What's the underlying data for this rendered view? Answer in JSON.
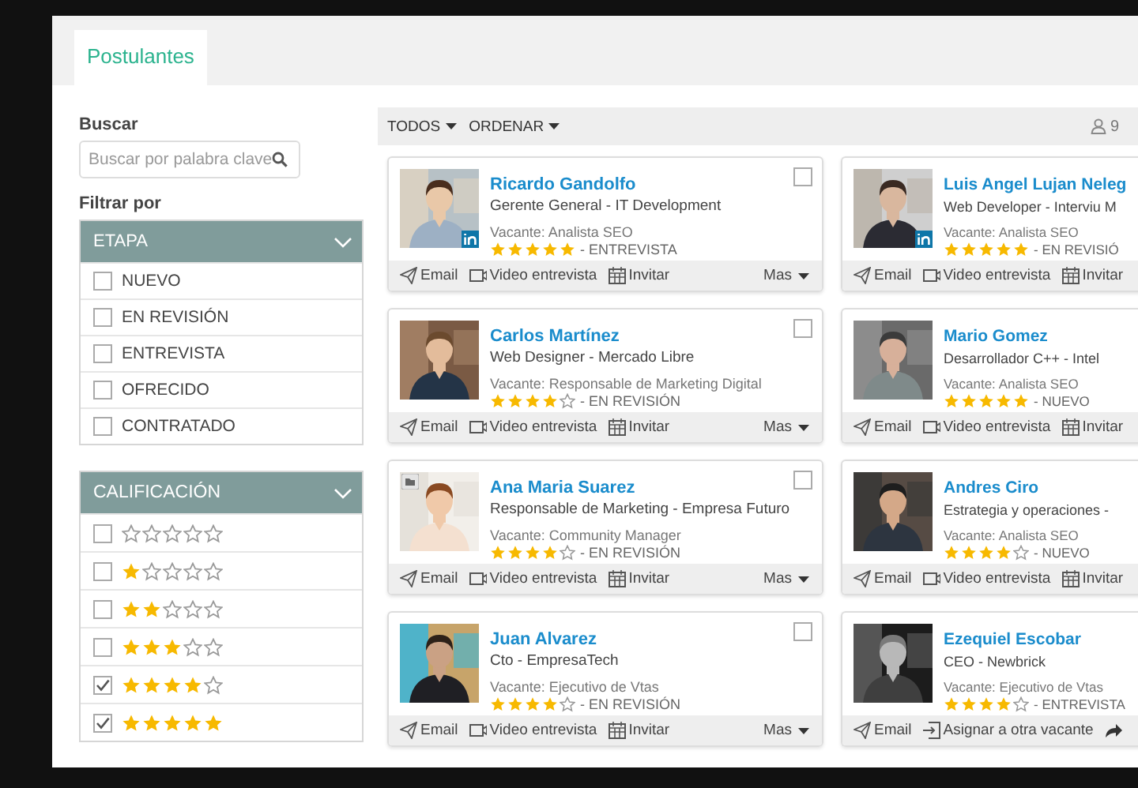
{
  "tabs": [
    {
      "label": "Postulantes",
      "selected": true
    }
  ],
  "search": {
    "label": "Buscar",
    "placeholder": "Buscar por palabra clave"
  },
  "filter_label": "Filtrar por",
  "stage_filter": {
    "title": "ETAPA",
    "expanded": true,
    "items": [
      {
        "label": "NUEVO",
        "checked": false
      },
      {
        "label": "EN REVISIÓN",
        "checked": false
      },
      {
        "label": "ENTREVISTA",
        "checked": false
      },
      {
        "label": "OFRECIDO",
        "checked": false
      },
      {
        "label": "CONTRATADO",
        "checked": false
      }
    ]
  },
  "rating_filter": {
    "title": "CALIFICACIÓN",
    "expanded": true,
    "items": [
      {
        "stars": 0,
        "checked": false
      },
      {
        "stars": 1,
        "checked": false
      },
      {
        "stars": 2,
        "checked": false
      },
      {
        "stars": 3,
        "checked": false
      },
      {
        "stars": 4,
        "checked": true
      },
      {
        "stars": 5,
        "checked": true
      }
    ]
  },
  "toolbar": {
    "menus": [
      "TODOS",
      "ORDENAR"
    ],
    "count": "9"
  },
  "candidates": [
    {
      "name": "Ricardo Gandolfo",
      "title": "Gerente General - IT Development",
      "vacancy": "Vacante: Analista SEO",
      "stars": 5,
      "stage": "- ENTREVISTA",
      "linkedin": true,
      "corner_icon": false,
      "checked": false,
      "actions": [
        {
          "kind": "email",
          "label": "Email"
        },
        {
          "kind": "video",
          "label": "Video entrevista"
        },
        {
          "kind": "invite",
          "label": "Invitar"
        },
        {
          "kind": "more",
          "label": "Mas"
        }
      ]
    },
    {
      "name": "Luis Angel Lujan Neleg",
      "title": "Web Developer - Interviu M",
      "vacancy": "Vacante: Analista SEO",
      "stars": 5,
      "stage": "- EN REVISIÓ",
      "linkedin": true,
      "corner_icon": false,
      "actions": [
        {
          "kind": "email",
          "label": "Email"
        },
        {
          "kind": "video",
          "label": "Video entrevista"
        },
        {
          "kind": "invite",
          "label": "Invitar"
        }
      ]
    },
    {
      "name": "Carlos Martínez",
      "title": "Web Designer - Mercado Libre",
      "vacancy": "Vacante: Responsable de Marketing Digital",
      "stars": 4,
      "stage": "- EN REVISIÓN",
      "linkedin": false,
      "corner_icon": false,
      "checked": false,
      "actions": [
        {
          "kind": "email",
          "label": "Email"
        },
        {
          "kind": "video",
          "label": "Video entrevista"
        },
        {
          "kind": "invite",
          "label": "Invitar"
        },
        {
          "kind": "more",
          "label": "Mas"
        }
      ]
    },
    {
      "name": "Mario Gomez",
      "title": "Desarrollador C++ - Intel",
      "vacancy": "Vacante: Analista SEO",
      "stars": 5,
      "stage": "- NUEVO",
      "linkedin": false,
      "corner_icon": false,
      "actions": [
        {
          "kind": "email",
          "label": "Email"
        },
        {
          "kind": "video",
          "label": "Video entrevista"
        },
        {
          "kind": "invite",
          "label": "Invitar"
        }
      ]
    },
    {
      "name": "Ana Maria Suarez",
      "title": "Responsable de Marketing - Empresa Futuro",
      "vacancy": "Vacante: Community Manager",
      "stars": 4,
      "stage": "- EN REVISIÓN",
      "linkedin": false,
      "corner_icon": true,
      "checked": false,
      "actions": [
        {
          "kind": "email",
          "label": "Email"
        },
        {
          "kind": "video",
          "label": "Video entrevista"
        },
        {
          "kind": "invite",
          "label": "Invitar"
        },
        {
          "kind": "more",
          "label": "Mas"
        }
      ]
    },
    {
      "name": "Andres Ciro",
      "title": "Estrategia y operaciones -",
      "vacancy": "Vacante: Analista SEO",
      "stars": 4,
      "stage": "- NUEVO",
      "linkedin": false,
      "corner_icon": false,
      "actions": [
        {
          "kind": "email",
          "label": "Email"
        },
        {
          "kind": "video",
          "label": "Video entrevista"
        },
        {
          "kind": "invite",
          "label": "Invitar"
        }
      ]
    },
    {
      "name": "Juan Alvarez",
      "title": "Cto - EmpresaTech",
      "vacancy": "Vacante: Ejecutivo de Vtas",
      "stars": 4,
      "stage": "- EN REVISIÓN",
      "linkedin": false,
      "corner_icon": false,
      "checked": false,
      "actions": [
        {
          "kind": "email",
          "label": "Email"
        },
        {
          "kind": "video",
          "label": "Video entrevista"
        },
        {
          "kind": "invite",
          "label": "Invitar"
        },
        {
          "kind": "more",
          "label": "Mas"
        }
      ]
    },
    {
      "name": "Ezequiel Escobar",
      "title": "CEO - Newbrick",
      "vacancy": "Vacante: Ejecutivo de Vtas",
      "stars": 4,
      "stage": "- ENTREVISTA",
      "linkedin": false,
      "corner_icon": false,
      "actions": [
        {
          "kind": "email",
          "label": "Email"
        },
        {
          "kind": "assign",
          "label": "Asignar a otra vacante"
        },
        {
          "kind": "share"
        }
      ]
    }
  ]
}
